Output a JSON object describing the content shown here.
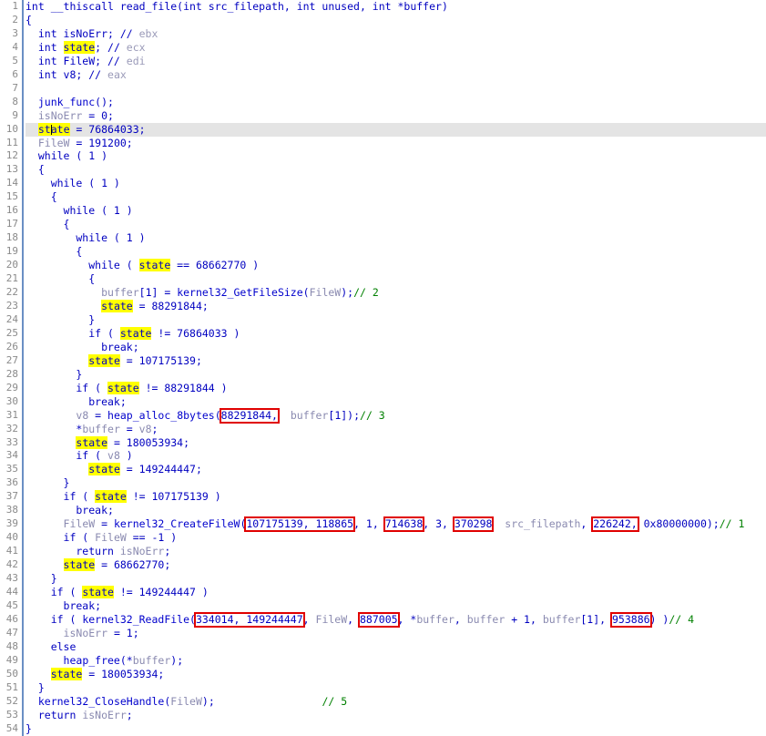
{
  "app": {
    "kind": "decompiler-pseudocode-view",
    "title": "read_file",
    "total_lines": 54,
    "current_line": 10,
    "highlighted_identifier": "state"
  },
  "colors": {
    "background": "#ffffff",
    "gutter_separator": "#6a8fc4",
    "line_number": "#8a8a8a",
    "keyword": "#0000c0",
    "function": "#0000cc",
    "variable": "#8a8ab0",
    "comment": "#008000",
    "register_comment": "#9a9ab8",
    "highlight": "#ffff00",
    "current_line": "#e4e4e4",
    "annotation_box": "#e00000"
  },
  "line_numbers": [
    1,
    2,
    3,
    4,
    5,
    6,
    7,
    8,
    9,
    10,
    11,
    12,
    13,
    14,
    15,
    16,
    17,
    18,
    19,
    20,
    21,
    22,
    23,
    24,
    25,
    26,
    27,
    28,
    29,
    30,
    31,
    32,
    33,
    34,
    35,
    36,
    37,
    38,
    39,
    40,
    41,
    42,
    43,
    44,
    45,
    46,
    47,
    48,
    49,
    50,
    51,
    52,
    53,
    54
  ],
  "code": {
    "l1": "int __thiscall read_file(int src_filepath, int unused, int *buffer)",
    "l2": "{",
    "l3_indent": "  int isNoErr; // ",
    "l3_reg": "ebx",
    "l4_pre": "  int ",
    "l4_hl": "state",
    "l4_post": "; // ",
    "l4_reg": "ecx",
    "l5_pre": "  int FileW; // ",
    "l5_reg": "edi",
    "l6_pre": "  int v8; // ",
    "l6_reg": "eax",
    "l7": "",
    "l8_fn": "junk_func",
    "l8_post": "();",
    "l9_var": "isNoErr",
    "l9_post": " = 0;",
    "l10_hl_a": "st",
    "l10_hl_b": "ate",
    "l10_post": " = 76864033;",
    "l11_var": "FileW",
    "l11_post": " = 191200;",
    "l12": "  while ( 1 )",
    "l13": "  {",
    "l14": "    while ( 1 )",
    "l15": "    {",
    "l16": "      while ( 1 )",
    "l17": "      {",
    "l18": "        while ( 1 )",
    "l19": "        {",
    "l20_pre": "          while ( ",
    "l20_hl": "state",
    "l20_post": " == 68662770 )",
    "l21": "          {",
    "l22_var1": "buffer",
    "l22_mid": "[1] = ",
    "l22_fn": "kernel32_GetFileSize",
    "l22_p1": "(",
    "l22_var2": "FileW",
    "l22_p2": ");",
    "l22_cmt": "// 2",
    "l23_hl": "state",
    "l23_post": " = 88291844;",
    "l24": "          }",
    "l25_pre": "          if ( ",
    "l25_hl": "state",
    "l25_post": " != 76864033 )",
    "l26": "            break;",
    "l27_hl": "state",
    "l27_post": " = 107175139;",
    "l28": "        }",
    "l29_pre": "        if ( ",
    "l29_hl": "state",
    "l29_post": " != 88291844 )",
    "l30": "          break;",
    "l31_var": "v8",
    "l31_mid": " = ",
    "l31_fn": "heap_alloc_8bytes",
    "l31_p1": "(",
    "l31_box": "88291844,",
    "l31_sp": "  ",
    "l31_var2": "buffer",
    "l31_p2": "[1]);",
    "l31_cmt": "// 3",
    "l32_mid": "*",
    "l32_var": "buffer",
    "l32_post": " = ",
    "l32_var2": "v8",
    "l32_end": ";",
    "l33_hl": "state",
    "l33_post": " = 180053934;",
    "l34_pre": "        if ( ",
    "l34_var": "v8",
    "l34_post": " )",
    "l35_hl": "state",
    "l35_post": " = 149244447;",
    "l36": "      }",
    "l37_pre": "      if ( ",
    "l37_hl": "state",
    "l37_post": " != 107175139 )",
    "l38": "        break;",
    "l39_var": "FileW",
    "l39_mid": " = ",
    "l39_fn": "kernel32_CreateFileW",
    "l39_p1": "(",
    "l39_box1": "107175139, 118865",
    "l39_s1": ", 1, ",
    "l39_box2": "714638",
    "l39_s2": ", 3, ",
    "l39_box3": "370298",
    "l39_s3": "  ",
    "l39_var2": "src_filepath",
    "l39_s4": ", ",
    "l39_box4": "226242,",
    "l39_s5": " 0x80000000);",
    "l39_cmt": "// 1",
    "l40_pre": "      if ( ",
    "l40_var": "FileW",
    "l40_post": " == -1 )",
    "l41_pre": "        return ",
    "l41_var": "isNoErr",
    "l41_post": ";",
    "l42_hl": "state",
    "l42_post": " = 68662770;",
    "l43": "    }",
    "l44_pre": "    if ( ",
    "l44_hl": "state",
    "l44_post": " != 149244447 )",
    "l45": "      break;",
    "l46_pre": "    if ( ",
    "l46_fn": "kernel32_ReadFile",
    "l46_p1": "(",
    "l46_box1": "334014, 149244447",
    "l46_s1": ", ",
    "l46_var1": "FileW",
    "l46_s2": ", ",
    "l46_box2": "887005",
    "l46_s3": ", *",
    "l46_var2": "buffer",
    "l46_s4": ", ",
    "l46_var3": "buffer",
    "l46_s5": " + 1, ",
    "l46_var4": "buffer",
    "l46_s6": "[1], ",
    "l46_box3": "953886",
    "l46_s7": ") )",
    "l46_cmt": "// 4",
    "l47_var": "isNoErr",
    "l47_post": " = 1;",
    "l48": "    else",
    "l49_fn": "heap_free",
    "l49_p1": "(*",
    "l49_var": "buffer",
    "l49_p2": ");",
    "l50_hl": "state",
    "l50_post": " = 180053934;",
    "l51": "  }",
    "l52_fn": "kernel32_CloseHandle",
    "l52_p1": "(",
    "l52_var": "FileW",
    "l52_p2": ");",
    "l52_sp": "                 ",
    "l52_cmt": "// 5",
    "l53_pre": "  return ",
    "l53_var": "isNoErr",
    "l53_post": ";",
    "l54": "}"
  },
  "annotations": {
    "red_boxes": [
      {
        "line": 31,
        "text": "88291844,"
      },
      {
        "line": 39,
        "text": "107175139, 118865"
      },
      {
        "line": 39,
        "text": "714638"
      },
      {
        "line": 39,
        "text": "370298"
      },
      {
        "line": 39,
        "text": "226242,"
      },
      {
        "line": 46,
        "text": "334014, 149244447"
      },
      {
        "line": 46,
        "text": "887005"
      },
      {
        "line": 46,
        "text": "953886"
      }
    ],
    "numbered_comments": [
      "// 1",
      "// 2",
      "// 3",
      "// 4",
      "// 5"
    ]
  }
}
